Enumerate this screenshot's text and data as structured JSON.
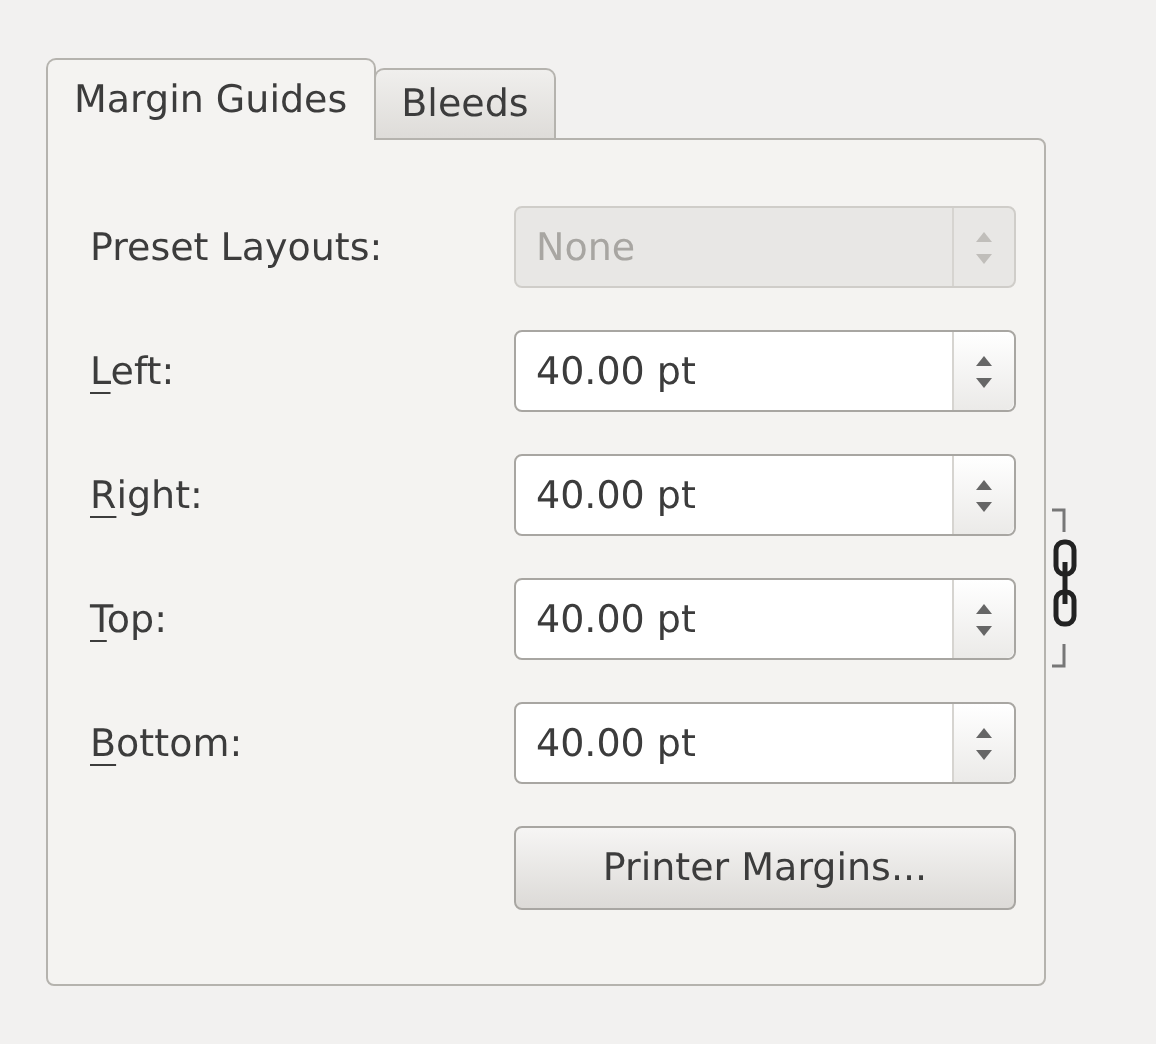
{
  "tabs": [
    {
      "label": "Margin Guides",
      "selected": true
    },
    {
      "label": "Bleeds",
      "selected": false
    }
  ],
  "preset": {
    "label": "Preset Layouts:",
    "value": "None",
    "disabled": true
  },
  "margins": [
    {
      "label": "Left:",
      "underline_first": true,
      "value": "40.00 pt"
    },
    {
      "label": "Right:",
      "underline_first": true,
      "value": "40.00 pt"
    },
    {
      "label": "Top:",
      "underline_first": true,
      "value": "40.00 pt"
    },
    {
      "label": "Bottom:",
      "underline_first": true,
      "value": "40.00 pt"
    }
  ],
  "linked": true,
  "button": "Printer Margins..."
}
